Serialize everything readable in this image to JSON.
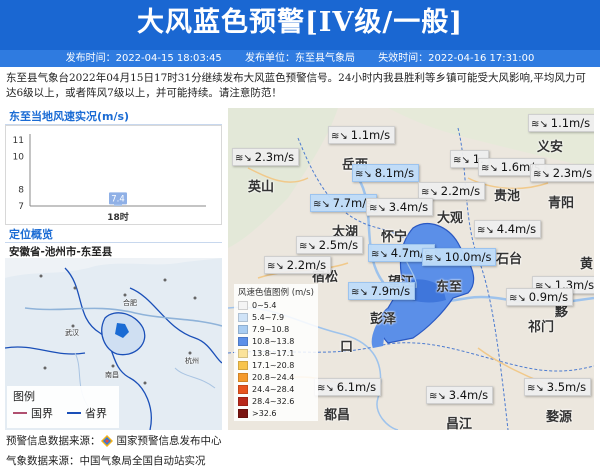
{
  "header": {
    "title": "大风蓝色预警[IV级/一般]"
  },
  "meta": {
    "issue_time": "发布时间：2022-04-15 18:03:45",
    "issuer": "发布单位：东至县气象局",
    "expire_time": "失效时间：2022-04-16 17:31:00"
  },
  "description": "东至县气象台2022年04月15日17时31分继续发布大风蓝色预警信号。24小时内我县胜利等乡镇可能受大风影响,平均风力可达6级以上，或者阵风7级以上，并可能持续。请注意防范！",
  "wind_section": {
    "title": "东至当地风速实况(m/s)"
  },
  "chart_data": {
    "type": "bar",
    "categories": [
      "18时"
    ],
    "values": [
      7.4
    ],
    "title": "东至当地风速实况(m/s)",
    "xlabel": "",
    "ylabel": "",
    "ylim": [
      7,
      11
    ],
    "yticks": [
      "7",
      "8",
      "10",
      "11"
    ],
    "grid": false
  },
  "location": {
    "title": "定位概览",
    "path": "安徽省-池州市-东至县"
  },
  "minimap": {
    "cities": [
      "合肥",
      "武汉",
      "南昌",
      "杭州"
    ],
    "legend_title": "图例",
    "legend_items": [
      {
        "label": "国界",
        "color": "#b05070"
      },
      {
        "label": "省界",
        "color": "#1a4fb8"
      }
    ]
  },
  "mainmap": {
    "places": [
      {
        "name": "岳西"
      },
      {
        "name": "义安"
      },
      {
        "name": "英山"
      },
      {
        "name": "贵池"
      },
      {
        "name": "青阳"
      },
      {
        "name": "大观"
      },
      {
        "name": "太湖"
      },
      {
        "name": "怀宁"
      },
      {
        "name": "石台"
      },
      {
        "name": "宿松"
      },
      {
        "name": "望江"
      },
      {
        "name": "东至"
      },
      {
        "name": "彭泽"
      },
      {
        "name": "祁门"
      },
      {
        "name": "口"
      },
      {
        "name": "都昌"
      },
      {
        "name": "昌江"
      },
      {
        "name": "婺源"
      },
      {
        "name": "黟"
      },
      {
        "name": "黄"
      }
    ],
    "wind_labels": [
      {
        "text": "1.1m/s",
        "style": "gray"
      },
      {
        "text": "1.1m/s",
        "style": "gray"
      },
      {
        "text": "2.3m/s",
        "style": "gray"
      },
      {
        "text": "8.1m/s",
        "style": "blue"
      },
      {
        "text": "1.",
        "style": "gray"
      },
      {
        "text": "1.6m/s",
        "style": "gray"
      },
      {
        "text": "2.3m/s",
        "style": "gray"
      },
      {
        "text": "2.2m/s",
        "style": "gray"
      },
      {
        "text": "7.7m/s",
        "style": "blue"
      },
      {
        "text": "3.4m/s",
        "style": "gray"
      },
      {
        "text": "4.4m/s",
        "style": "gray"
      },
      {
        "text": "2.5m/s",
        "style": "gray"
      },
      {
        "text": "4.7m/s",
        "style": "blue"
      },
      {
        "text": "10.0m/s",
        "style": "blue"
      },
      {
        "text": "2.2m/s",
        "style": "gray"
      },
      {
        "text": "7.9m/s",
        "style": "blue"
      },
      {
        "text": "1.3m/s",
        "style": "gray"
      },
      {
        "text": "0.9m/s",
        "style": "gray"
      },
      {
        "text": "3.4m/s",
        "style": "gray"
      },
      {
        "text": "3.5m/s",
        "style": "gray"
      },
      {
        "text": "6.1m/s",
        "style": "gray"
      }
    ],
    "speed_legend": {
      "title": "风速色值图例 (m/s)",
      "items": [
        {
          "label": "0~5.4",
          "color": "#f4f4f4"
        },
        {
          "label": "5.4~7.9",
          "color": "#cfe3f7"
        },
        {
          "label": "7.9~10.8",
          "color": "#a9cdf2"
        },
        {
          "label": "10.8~13.8",
          "color": "#5b8fe8"
        },
        {
          "label": "13.8~17.1",
          "color": "#fbe39a"
        },
        {
          "label": "17.1~20.8",
          "color": "#f8c44c"
        },
        {
          "label": "20.8~24.4",
          "color": "#f59a2c"
        },
        {
          "label": "24.4~28.4",
          "color": "#e8541e"
        },
        {
          "label": "28.4~32.6",
          "color": "#b8281a"
        },
        {
          "label": ">32.6",
          "color": "#7a1410"
        }
      ]
    }
  },
  "footer": {
    "warning_source_label": "预警信息数据来源：",
    "warning_source": "国家预警信息发布中心",
    "weather_source_label": "气象数据来源：",
    "weather_source": "中国气象局全国自动站实况"
  }
}
